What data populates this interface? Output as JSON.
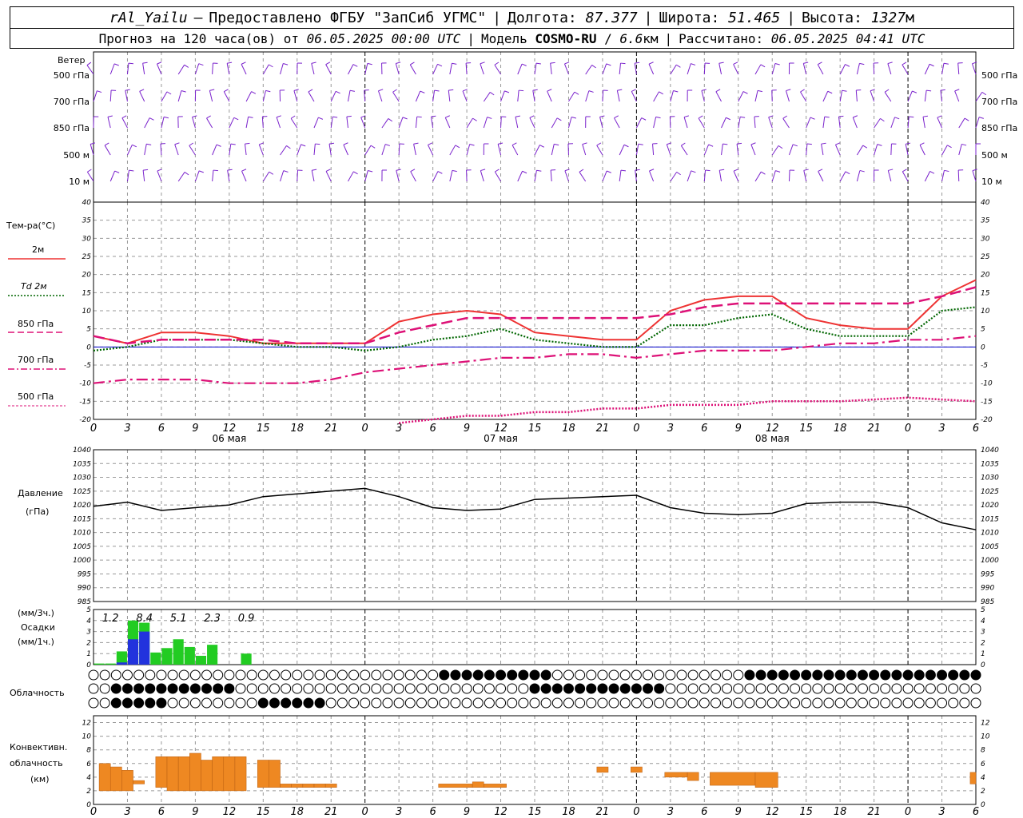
{
  "header": {
    "station": "rAl_Yailu",
    "dash": "–",
    "provider": "Предоставлено ФГБУ \"ЗапСиб УГМС\"",
    "lon_label": "Долгота:",
    "lon_value": "87.377",
    "lat_label": "Широта:",
    "lat_value": "51.465",
    "alt_label": "Высота:",
    "alt_value": "1327",
    "alt_unit": "м",
    "forecast_prefix": "Прогноз на 120 часа(ов) от",
    "forecast_start": "06.05.2025 00:00 UTC",
    "model_label": "Модель",
    "model_name": "COSMO-RU",
    "model_res": "6.6",
    "model_res_unit": "км",
    "calc_label": "Рассчитано:",
    "calc_time": "06.05.2025 04:41 UTC"
  },
  "colors": {
    "t2m": "#ee3333",
    "td2m": "#006600",
    "t850": "#dd1177",
    "t700": "#dd1177",
    "t500": "#dd1177",
    "zero_line": "#0000cc",
    "wind_barb": "#7a22cc",
    "pressure": "#000000",
    "precip_rain": "#22cc22",
    "precip_conv": "#2233dd",
    "conv_cloud": "#ee8822",
    "grid": "#999999"
  },
  "wind": {
    "title": "Ветер",
    "levels": [
      "500 гПа",
      "700 гПа",
      "850 гПа",
      "500 м",
      "10 м"
    ],
    "icon": "wind-barb-icon"
  },
  "temperature_legend": {
    "title": "Тем-ра(°С)",
    "items": [
      {
        "label": "2м",
        "style": "solid"
      },
      {
        "label": "Td 2м",
        "style": "dotted"
      },
      {
        "label": "850 гПа",
        "style": "dashed"
      },
      {
        "label": "700 гПа",
        "style": "dashdot"
      },
      {
        "label": "500 гПа",
        "style": "dotted"
      }
    ]
  },
  "x_axis": {
    "hour_ticks": [
      "0",
      "3",
      "6",
      "9",
      "12",
      "15",
      "18",
      "21",
      "0",
      "3",
      "6",
      "9",
      "12",
      "15",
      "18",
      "21",
      "0",
      "3",
      "6",
      "9",
      "12",
      "15",
      "18",
      "21",
      "0",
      "3",
      "6"
    ],
    "dates": [
      "06 мая",
      "07 мая",
      "08 мая"
    ]
  },
  "pressure_panel": {
    "title": "Давление",
    "unit": "(гПа)"
  },
  "precip_panel": {
    "unit_top": "(мм/3ч.)",
    "title": "Осадки",
    "unit_bottom": "(мм/1ч.)",
    "sums": [
      "1.2",
      "8.4",
      "5.1",
      "2.3",
      "0.9"
    ]
  },
  "cloud_panel": {
    "title": "Облачность",
    "icon": "cloud-cover-circle-icon"
  },
  "conv_panel": {
    "title": "Конвективн.",
    "title2": "облачность",
    "unit": "(км)"
  },
  "chart_data": [
    {
      "type": "line",
      "ylim": [
        -20,
        40
      ],
      "y_ticks": [
        -20,
        -15,
        -10,
        -5,
        0,
        5,
        10,
        15,
        20,
        25,
        30,
        35,
        40
      ],
      "x_hours": [
        0,
        3,
        6,
        9,
        12,
        15,
        18,
        21,
        24,
        27,
        30,
        33,
        36,
        39,
        42,
        45,
        48,
        51,
        54,
        57,
        60,
        63,
        66,
        69,
        72,
        75,
        78
      ],
      "series": [
        {
          "name": "2м",
          "values": [
            3,
            1,
            4,
            4,
            3,
            1,
            1,
            1,
            1,
            7,
            9,
            10,
            9,
            4,
            3,
            2,
            2,
            10,
            13,
            14,
            14,
            8,
            6,
            5,
            5,
            14,
            18.5
          ]
        },
        {
          "name": "Td 2м",
          "values": [
            -1,
            0,
            2,
            2,
            2,
            1,
            0,
            0,
            -1,
            0,
            2,
            3,
            5,
            2,
            1,
            0,
            0,
            6,
            6,
            8,
            9,
            5,
            3,
            3,
            3,
            10,
            11
          ]
        },
        {
          "name": "850 гПа",
          "values": [
            3,
            1,
            2,
            2,
            2,
            2,
            1,
            1,
            1,
            4,
            6,
            8,
            8,
            8,
            8,
            8,
            8,
            9,
            11,
            12,
            12,
            12,
            12,
            12,
            12,
            14,
            16.5
          ]
        },
        {
          "name": "700 гПа",
          "values": [
            -10,
            -9,
            -9,
            -9,
            -10,
            -10,
            -10,
            -9,
            -7,
            -6,
            -5,
            -4,
            -3,
            -3,
            -2,
            -2,
            -3,
            -2,
            -1,
            -1,
            -1,
            0,
            1,
            1,
            2,
            2,
            3
          ]
        },
        {
          "name": "500 гПа",
          "values": [
            null,
            null,
            null,
            null,
            null,
            null,
            null,
            null,
            null,
            -21,
            -20,
            -19,
            -19,
            -18,
            -18,
            -17,
            -17,
            -16,
            -16,
            -16,
            -15,
            -15,
            -15,
            -14.5,
            -14,
            -14.5,
            -15
          ]
        }
      ]
    },
    {
      "type": "line",
      "ylim": [
        985,
        1040
      ],
      "y_ticks": [
        985,
        990,
        995,
        1000,
        1005,
        1010,
        1015,
        1020,
        1025,
        1030,
        1035,
        1040
      ],
      "x_hours": [
        0,
        3,
        6,
        9,
        12,
        15,
        18,
        21,
        24,
        27,
        30,
        33,
        36,
        39,
        42,
        45,
        48,
        51,
        54,
        57,
        60,
        63,
        66,
        69,
        72,
        75,
        78
      ],
      "series": [
        {
          "name": "",
          "values": [
            1019.5,
            1021,
            1018,
            1019,
            1020,
            1023,
            1024,
            1025,
            1026,
            1023,
            1019,
            1018,
            1018.5,
            1022,
            1022.5,
            1023,
            1023.5,
            1019,
            1017,
            1016.5,
            1017,
            1020.5,
            1021,
            1021,
            1019,
            1013.5,
            1011
          ]
        }
      ]
    },
    {
      "type": "bar",
      "ylim": [
        0,
        5
      ],
      "y_ticks": [
        0,
        1,
        2,
        3,
        4,
        5
      ],
      "hours": [
        0,
        1,
        2,
        3,
        4,
        5,
        6,
        7,
        8,
        9,
        10,
        11,
        12,
        13,
        14,
        15
      ],
      "series": [
        {
          "name": "rain",
          "values": [
            0.1,
            0.1,
            1.2,
            4.0,
            3.8,
            1.1,
            1.5,
            2.3,
            1.6,
            0.8,
            1.8,
            0,
            0,
            1.0,
            0,
            0
          ]
        },
        {
          "name": "conv",
          "values": [
            0,
            0,
            0.2,
            2.3,
            3.0,
            0,
            0,
            0,
            0,
            0,
            0,
            0,
            0,
            0,
            0,
            0
          ]
        }
      ]
    },
    {
      "type": "bar",
      "ylim": [
        0,
        13
      ],
      "y_ticks": [
        0,
        2,
        4,
        6,
        8,
        10,
        12
      ],
      "segments": [
        {
          "h0": 0.5,
          "h1": 1.5,
          "b": 2,
          "t": 6
        },
        {
          "h0": 1.5,
          "h1": 2.5,
          "b": 2,
          "t": 5.5
        },
        {
          "h0": 2.5,
          "h1": 3.5,
          "b": 2,
          "t": 5
        },
        {
          "h0": 3.5,
          "h1": 4.5,
          "b": 3,
          "t": 3.5
        },
        {
          "h0": 5.5,
          "h1": 6.5,
          "b": 2.5,
          "t": 7
        },
        {
          "h0": 6.5,
          "h1": 7.5,
          "b": 2,
          "t": 7
        },
        {
          "h0": 7.5,
          "h1": 8.5,
          "b": 2,
          "t": 7
        },
        {
          "h0": 8.5,
          "h1": 9.5,
          "b": 2,
          "t": 7.5
        },
        {
          "h0": 9.5,
          "h1": 10.5,
          "b": 2,
          "t": 6.5
        },
        {
          "h0": 10.5,
          "h1": 11.5,
          "b": 2,
          "t": 7
        },
        {
          "h0": 11.5,
          "h1": 12.5,
          "b": 2,
          "t": 7
        },
        {
          "h0": 12.5,
          "h1": 13.5,
          "b": 2,
          "t": 7
        },
        {
          "h0": 14.5,
          "h1": 15.5,
          "b": 2.5,
          "t": 6.5
        },
        {
          "h0": 15.5,
          "h1": 16.5,
          "b": 2.5,
          "t": 6.5
        },
        {
          "h0": 16.5,
          "h1": 17.5,
          "b": 2.5,
          "t": 3
        },
        {
          "h0": 17.5,
          "h1": 18.5,
          "b": 2.5,
          "t": 3
        },
        {
          "h0": 18.5,
          "h1": 19.5,
          "b": 2.5,
          "t": 3
        },
        {
          "h0": 19.5,
          "h1": 20.5,
          "b": 2.5,
          "t": 3
        },
        {
          "h0": 20.5,
          "h1": 21.5,
          "b": 2.5,
          "t": 3
        },
        {
          "h0": 30.5,
          "h1": 33.5,
          "b": 2.5,
          "t": 3
        },
        {
          "h0": 33.5,
          "h1": 34.5,
          "b": 2.5,
          "t": 3.3
        },
        {
          "h0": 34.5,
          "h1": 36.5,
          "b": 2.5,
          "t": 3
        },
        {
          "h0": 44.5,
          "h1": 45.5,
          "b": 4.7,
          "t": 5.5
        },
        {
          "h0": 47.5,
          "h1": 48.5,
          "b": 4.7,
          "t": 5.5
        },
        {
          "h0": 50.5,
          "h1": 52.5,
          "b": 4,
          "t": 4.7
        },
        {
          "h0": 52.5,
          "h1": 53.5,
          "b": 3.5,
          "t": 4.7
        },
        {
          "h0": 54.5,
          "h1": 58.5,
          "b": 2.8,
          "t": 4.7
        },
        {
          "h0": 58.5,
          "h1": 60.5,
          "b": 2.5,
          "t": 4.7
        },
        {
          "h0": 77.5,
          "h1": 78,
          "b": 3,
          "t": 4.7
        }
      ]
    }
  ]
}
